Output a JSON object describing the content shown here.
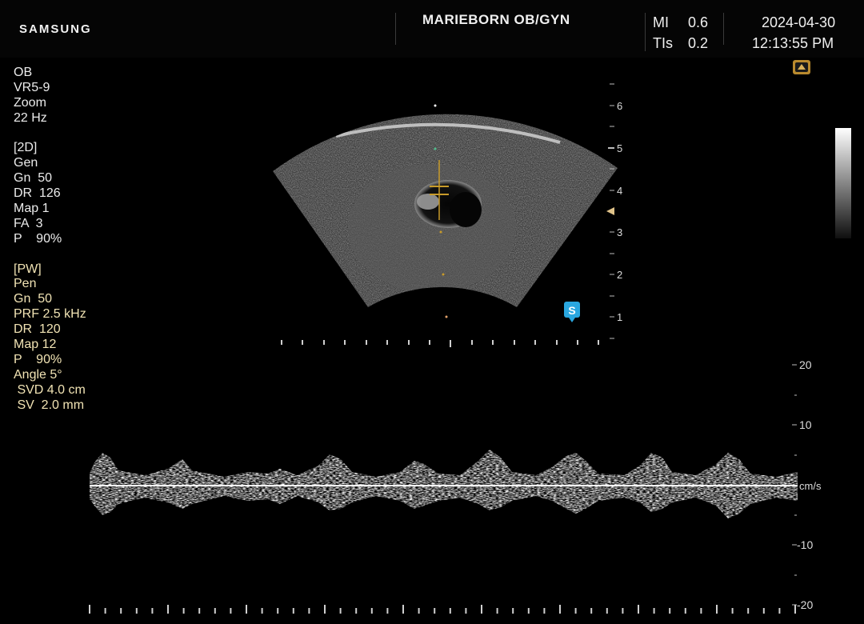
{
  "header": {
    "brand": "SAMSUNG",
    "facility": "MARIEBORN OB/GYN",
    "mi_label": "MI",
    "mi_value": "0.6",
    "tis_label": "TIs",
    "tis_value": "0.2",
    "date": "2024-04-30",
    "time": "12:13:55 PM"
  },
  "params": {
    "exam": [
      "OB",
      "VR5-9",
      "Zoom",
      "22 Hz"
    ],
    "mode2d": [
      "[2D]",
      "Gen",
      "Gn  50",
      "DR  126",
      "Map 1",
      "FA  3",
      "P    90%"
    ],
    "pw": [
      "[PW]",
      "Pen",
      "Gn  50",
      "PRF 2.5 kHz",
      "DR  120",
      "Map 12",
      "P    90%",
      "Angle 5°",
      " SVD 4.0 cm",
      " SV  2.0 mm"
    ]
  },
  "depth_scale": [
    "6",
    "5",
    "4",
    "3",
    "2",
    "1"
  ],
  "doppler_scale": {
    "unit": "cm/s",
    "labels": [
      "20",
      "10",
      "-10",
      "-20"
    ]
  },
  "icons": {
    "probe": "probe-orientation-icon",
    "s_marker": "s-marker-icon",
    "focus": "focus-arrow-icon"
  },
  "s_marker_text": "S"
}
